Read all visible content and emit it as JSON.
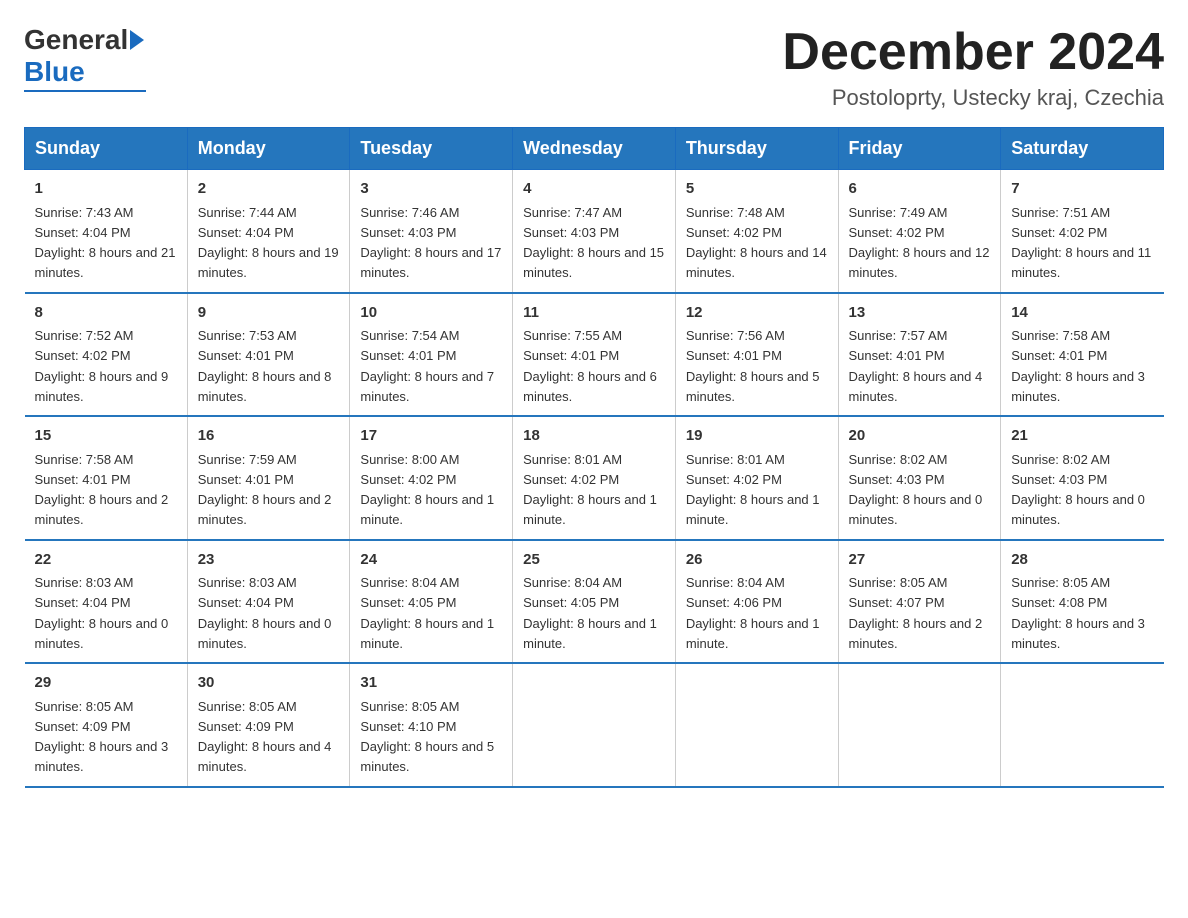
{
  "logo": {
    "general": "General",
    "blue": "Blue"
  },
  "title": "December 2024",
  "subtitle": "Postoloprty, Ustecky kraj, Czechia",
  "days_header": [
    "Sunday",
    "Monday",
    "Tuesday",
    "Wednesday",
    "Thursday",
    "Friday",
    "Saturday"
  ],
  "weeks": [
    [
      {
        "day": "1",
        "sunrise": "7:43 AM",
        "sunset": "4:04 PM",
        "daylight": "8 hours and 21 minutes."
      },
      {
        "day": "2",
        "sunrise": "7:44 AM",
        "sunset": "4:04 PM",
        "daylight": "8 hours and 19 minutes."
      },
      {
        "day": "3",
        "sunrise": "7:46 AM",
        "sunset": "4:03 PM",
        "daylight": "8 hours and 17 minutes."
      },
      {
        "day": "4",
        "sunrise": "7:47 AM",
        "sunset": "4:03 PM",
        "daylight": "8 hours and 15 minutes."
      },
      {
        "day": "5",
        "sunrise": "7:48 AM",
        "sunset": "4:02 PM",
        "daylight": "8 hours and 14 minutes."
      },
      {
        "day": "6",
        "sunrise": "7:49 AM",
        "sunset": "4:02 PM",
        "daylight": "8 hours and 12 minutes."
      },
      {
        "day": "7",
        "sunrise": "7:51 AM",
        "sunset": "4:02 PM",
        "daylight": "8 hours and 11 minutes."
      }
    ],
    [
      {
        "day": "8",
        "sunrise": "7:52 AM",
        "sunset": "4:02 PM",
        "daylight": "8 hours and 9 minutes."
      },
      {
        "day": "9",
        "sunrise": "7:53 AM",
        "sunset": "4:01 PM",
        "daylight": "8 hours and 8 minutes."
      },
      {
        "day": "10",
        "sunrise": "7:54 AM",
        "sunset": "4:01 PM",
        "daylight": "8 hours and 7 minutes."
      },
      {
        "day": "11",
        "sunrise": "7:55 AM",
        "sunset": "4:01 PM",
        "daylight": "8 hours and 6 minutes."
      },
      {
        "day": "12",
        "sunrise": "7:56 AM",
        "sunset": "4:01 PM",
        "daylight": "8 hours and 5 minutes."
      },
      {
        "day": "13",
        "sunrise": "7:57 AM",
        "sunset": "4:01 PM",
        "daylight": "8 hours and 4 minutes."
      },
      {
        "day": "14",
        "sunrise": "7:58 AM",
        "sunset": "4:01 PM",
        "daylight": "8 hours and 3 minutes."
      }
    ],
    [
      {
        "day": "15",
        "sunrise": "7:58 AM",
        "sunset": "4:01 PM",
        "daylight": "8 hours and 2 minutes."
      },
      {
        "day": "16",
        "sunrise": "7:59 AM",
        "sunset": "4:01 PM",
        "daylight": "8 hours and 2 minutes."
      },
      {
        "day": "17",
        "sunrise": "8:00 AM",
        "sunset": "4:02 PM",
        "daylight": "8 hours and 1 minute."
      },
      {
        "day": "18",
        "sunrise": "8:01 AM",
        "sunset": "4:02 PM",
        "daylight": "8 hours and 1 minute."
      },
      {
        "day": "19",
        "sunrise": "8:01 AM",
        "sunset": "4:02 PM",
        "daylight": "8 hours and 1 minute."
      },
      {
        "day": "20",
        "sunrise": "8:02 AM",
        "sunset": "4:03 PM",
        "daylight": "8 hours and 0 minutes."
      },
      {
        "day": "21",
        "sunrise": "8:02 AM",
        "sunset": "4:03 PM",
        "daylight": "8 hours and 0 minutes."
      }
    ],
    [
      {
        "day": "22",
        "sunrise": "8:03 AM",
        "sunset": "4:04 PM",
        "daylight": "8 hours and 0 minutes."
      },
      {
        "day": "23",
        "sunrise": "8:03 AM",
        "sunset": "4:04 PM",
        "daylight": "8 hours and 0 minutes."
      },
      {
        "day": "24",
        "sunrise": "8:04 AM",
        "sunset": "4:05 PM",
        "daylight": "8 hours and 1 minute."
      },
      {
        "day": "25",
        "sunrise": "8:04 AM",
        "sunset": "4:05 PM",
        "daylight": "8 hours and 1 minute."
      },
      {
        "day": "26",
        "sunrise": "8:04 AM",
        "sunset": "4:06 PM",
        "daylight": "8 hours and 1 minute."
      },
      {
        "day": "27",
        "sunrise": "8:05 AM",
        "sunset": "4:07 PM",
        "daylight": "8 hours and 2 minutes."
      },
      {
        "day": "28",
        "sunrise": "8:05 AM",
        "sunset": "4:08 PM",
        "daylight": "8 hours and 3 minutes."
      }
    ],
    [
      {
        "day": "29",
        "sunrise": "8:05 AM",
        "sunset": "4:09 PM",
        "daylight": "8 hours and 3 minutes."
      },
      {
        "day": "30",
        "sunrise": "8:05 AM",
        "sunset": "4:09 PM",
        "daylight": "8 hours and 4 minutes."
      },
      {
        "day": "31",
        "sunrise": "8:05 AM",
        "sunset": "4:10 PM",
        "daylight": "8 hours and 5 minutes."
      },
      {
        "day": "",
        "sunrise": "",
        "sunset": "",
        "daylight": ""
      },
      {
        "day": "",
        "sunrise": "",
        "sunset": "",
        "daylight": ""
      },
      {
        "day": "",
        "sunrise": "",
        "sunset": "",
        "daylight": ""
      },
      {
        "day": "",
        "sunrise": "",
        "sunset": "",
        "daylight": ""
      }
    ]
  ]
}
